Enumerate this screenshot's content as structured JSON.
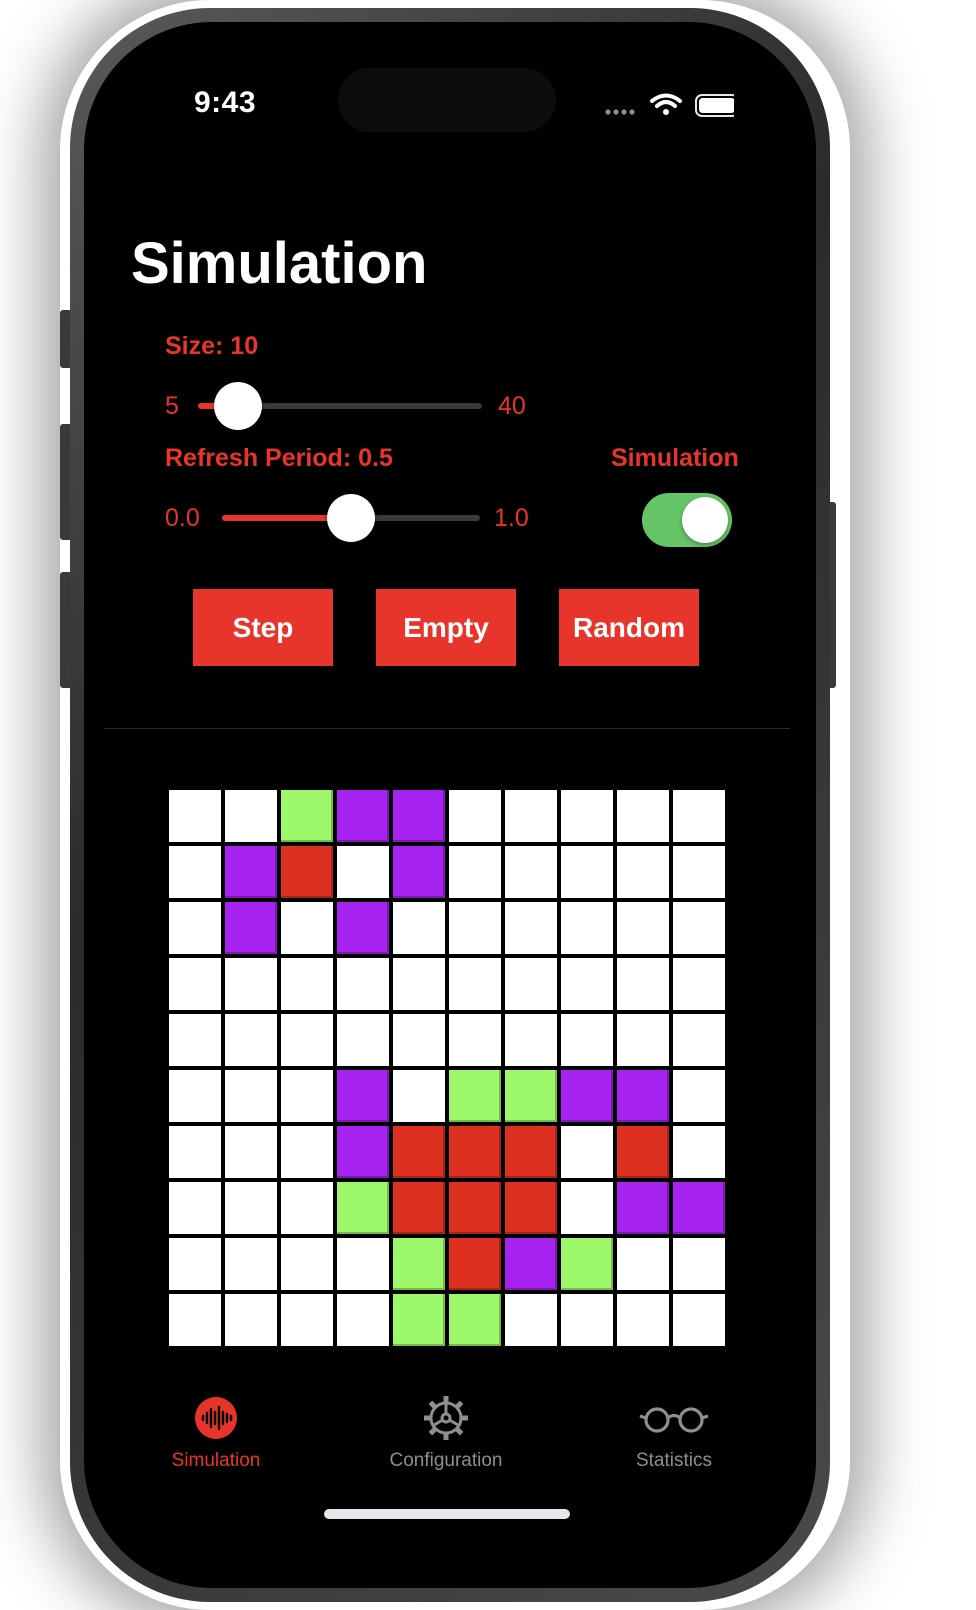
{
  "status": {
    "time": "9:43"
  },
  "page": {
    "title": "Simulation"
  },
  "size_control": {
    "label": "Size: 10",
    "min": "5",
    "max": "40",
    "value_fraction": 0.14
  },
  "refresh_control": {
    "label": "Refresh Period: 0.5",
    "min": "0.0",
    "max": "1.0",
    "value_fraction": 0.5
  },
  "simulation_toggle": {
    "label": "Simulation",
    "on": true
  },
  "buttons": {
    "step": "Step",
    "empty": "Empty",
    "random": "Random"
  },
  "grid": {
    "rows": [
      "..GPP.....",
      ".PR.P.....",
      ".P.P......",
      "..........",
      "..........",
      "...P.GGPP.",
      "...PRRR.R.",
      "...GRRR.PP",
      "....GRPG..",
      "....GG...."
    ],
    "colors": {
      "G": "#9ef96a",
      "P": "#a622ee",
      "R": "#dd3020",
      ".": "#ffffff"
    }
  },
  "tabs": [
    {
      "label": "Simulation",
      "icon": "waveform-icon",
      "active": true
    },
    {
      "label": "Configuration",
      "icon": "gear-icon",
      "active": false
    },
    {
      "label": "Statistics",
      "icon": "eyeglasses-icon",
      "active": false
    }
  ],
  "accent_color": "#e8352b"
}
